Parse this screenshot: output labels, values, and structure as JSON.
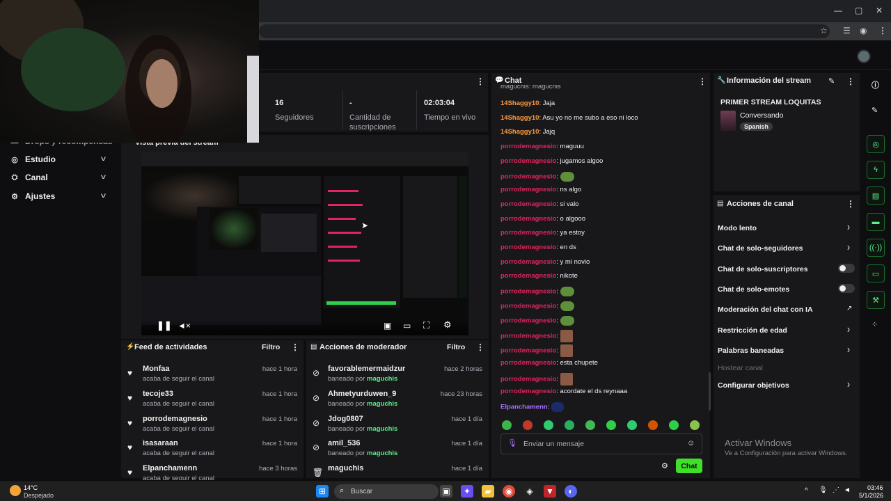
{
  "browser": {
    "window_controls": [
      "—",
      "▢",
      "✕"
    ],
    "toolbar_icons": [
      "☆",
      "☰",
      "◉",
      "⋮"
    ]
  },
  "nav": {
    "partial_item": "Drops y recompensas",
    "items": [
      {
        "label": "Estudio",
        "icon": "◎"
      },
      {
        "label": "Canal",
        "icon": "⛭"
      },
      {
        "label": "Ajustes",
        "icon": "⚙"
      }
    ]
  },
  "stats": [
    {
      "value": "16",
      "label": "Seguidores"
    },
    {
      "value": "-",
      "label": "Cantidad de suscripciones"
    },
    {
      "value": "02:03:04",
      "label": "Tiempo en vivo"
    }
  ],
  "preview": {
    "title": "Vista previa del stream"
  },
  "activity_feed": {
    "title": "Feed de actividades",
    "filter": "Filtro",
    "items": [
      {
        "name": "Monfaa",
        "sub": "acaba de seguir el canal",
        "time": "hace 1 hora"
      },
      {
        "name": "tecoje33",
        "sub": "acaba de seguir el canal",
        "time": "hace 1 hora"
      },
      {
        "name": "porrodemagnesio",
        "sub": "acaba de seguir el canal",
        "time": "hace 1 hora"
      },
      {
        "name": "isasaraan",
        "sub": "acaba de seguir el canal",
        "time": "hace 1 hora"
      },
      {
        "name": "Elpanchamenn",
        "sub": "acaba de seguir el canal",
        "time": "hace 3 horas"
      }
    ]
  },
  "mod_actions": {
    "title": "Acciones de moderador",
    "filter": "Filtro",
    "items": [
      {
        "name": "favorablemermaidzur",
        "prefix": "baneado por",
        "by": "maguchis",
        "time": "hace 2 horas"
      },
      {
        "name": "Ahmetyurduwen_9",
        "prefix": "baneado por",
        "by": "maguchis",
        "time": "hace 23 horas"
      },
      {
        "name": "Jdog0807",
        "prefix": "baneado por",
        "by": "maguchis",
        "time": "hace 1 día"
      },
      {
        "name": "amil_536",
        "prefix": "baneado por",
        "by": "maguchis",
        "time": "hace 1 día"
      },
      {
        "name": "maguchis",
        "prefix": "",
        "by": "",
        "time": "hace 1 día"
      }
    ]
  },
  "chat": {
    "title": "Chat",
    "top_partial": "maguchis: maguchis",
    "messages": [
      {
        "user": "14Shaggy10",
        "color": "#ff9b3d",
        "text": "Jaja",
        "emote": ""
      },
      {
        "user": "14Shaggy10",
        "color": "#ff9b3d",
        "text": "Asu yo no me subo a eso ni loco",
        "emote": ""
      },
      {
        "user": "14Shaggy10",
        "color": "#ff9b3d",
        "text": "Jajq",
        "emote": ""
      },
      {
        "user": "porrodemagnesio",
        "color": "#e0255e",
        "text": "maguuu",
        "emote": ""
      },
      {
        "user": "porrodemagnesio",
        "color": "#e0255e",
        "text": "jugamos algoo",
        "emote": ""
      },
      {
        "user": "porrodemagnesio",
        "color": "#e0255e",
        "text": "",
        "emote": "frog"
      },
      {
        "user": "porrodemagnesio",
        "color": "#e0255e",
        "text": "ns algo",
        "emote": ""
      },
      {
        "user": "porrodemagnesio",
        "color": "#e0255e",
        "text": "si valo",
        "emote": ""
      },
      {
        "user": "porrodemagnesio",
        "color": "#e0255e",
        "text": "o algooo",
        "emote": ""
      },
      {
        "user": "porrodemagnesio",
        "color": "#e0255e",
        "text": "ya estoy",
        "emote": ""
      },
      {
        "user": "porrodemagnesio",
        "color": "#e0255e",
        "text": "en ds",
        "emote": ""
      },
      {
        "user": "porrodemagnesio",
        "color": "#e0255e",
        "text": "y mi novio",
        "emote": ""
      },
      {
        "user": "porrodemagnesio",
        "color": "#e0255e",
        "text": "nikote",
        "emote": ""
      },
      {
        "user": "porrodemagnesio",
        "color": "#e0255e",
        "text": "",
        "emote": "frog"
      },
      {
        "user": "porrodemagnesio",
        "color": "#e0255e",
        "text": "",
        "emote": "frog"
      },
      {
        "user": "porrodemagnesio",
        "color": "#e0255e",
        "text": "",
        "emote": "frog"
      },
      {
        "user": "porrodemagnesio",
        "color": "#e0255e",
        "text": "",
        "emote": "face"
      },
      {
        "user": "porrodemagnesio",
        "color": "#e0255e",
        "text": "",
        "emote": "face"
      },
      {
        "user": "porrodemagnesio",
        "color": "#e0255e",
        "text": "esta chupete",
        "emote": ""
      },
      {
        "user": "porrodemagnesio",
        "color": "#e0255e",
        "text": "",
        "emote": "face"
      },
      {
        "user": "porrodemagnesio",
        "color": "#e0255e",
        "text": "acordate el ds reynaaa",
        "emote": ""
      },
      {
        "user": "Elpanchamenn",
        "color": "#a970ff",
        "text": "",
        "emote": "blue"
      }
    ],
    "input_placeholder": "Enviar un mensaje",
    "send_label": "Chat"
  },
  "stream_info": {
    "title": "Información del stream",
    "stream_title": "PRIMER STREAM LOQUITAS",
    "category": "Conversando",
    "tag": "Spanish"
  },
  "channel_actions": {
    "title": "Acciones de canal",
    "items": [
      {
        "label": "Modo lento",
        "control": "chevron"
      },
      {
        "label": "Chat de solo-seguidores",
        "control": "chevron"
      },
      {
        "label": "Chat de solo-suscriptores",
        "control": "toggle"
      },
      {
        "label": "Chat de solo-emotes",
        "control": "toggle"
      },
      {
        "label": "Moderación del chat con IA",
        "control": "external"
      },
      {
        "label": "Restricción de edad",
        "control": "chevron"
      },
      {
        "label": "Palabras baneadas",
        "control": "chevron"
      },
      {
        "label": "Hostear canal",
        "control": "disabled"
      },
      {
        "label": "Configurar objetivos",
        "control": "chevron"
      }
    ]
  },
  "windows_watermark": {
    "line1": "Activar Windows",
    "line2": "Ve a Configuración para activar Windows."
  },
  "taskbar": {
    "weather_temp": "14°C",
    "weather_desc": "Despejado",
    "search_placeholder": "Buscar",
    "time": "03:46",
    "date": "5/1/2026"
  },
  "colors": {
    "accent_green": "#00f593",
    "send_green": "#3fe028",
    "mod_green": "#57f287",
    "shaggy_orange": "#ff9b3d",
    "porro_red": "#e0255e",
    "panchamenn_purple": "#a970ff"
  }
}
